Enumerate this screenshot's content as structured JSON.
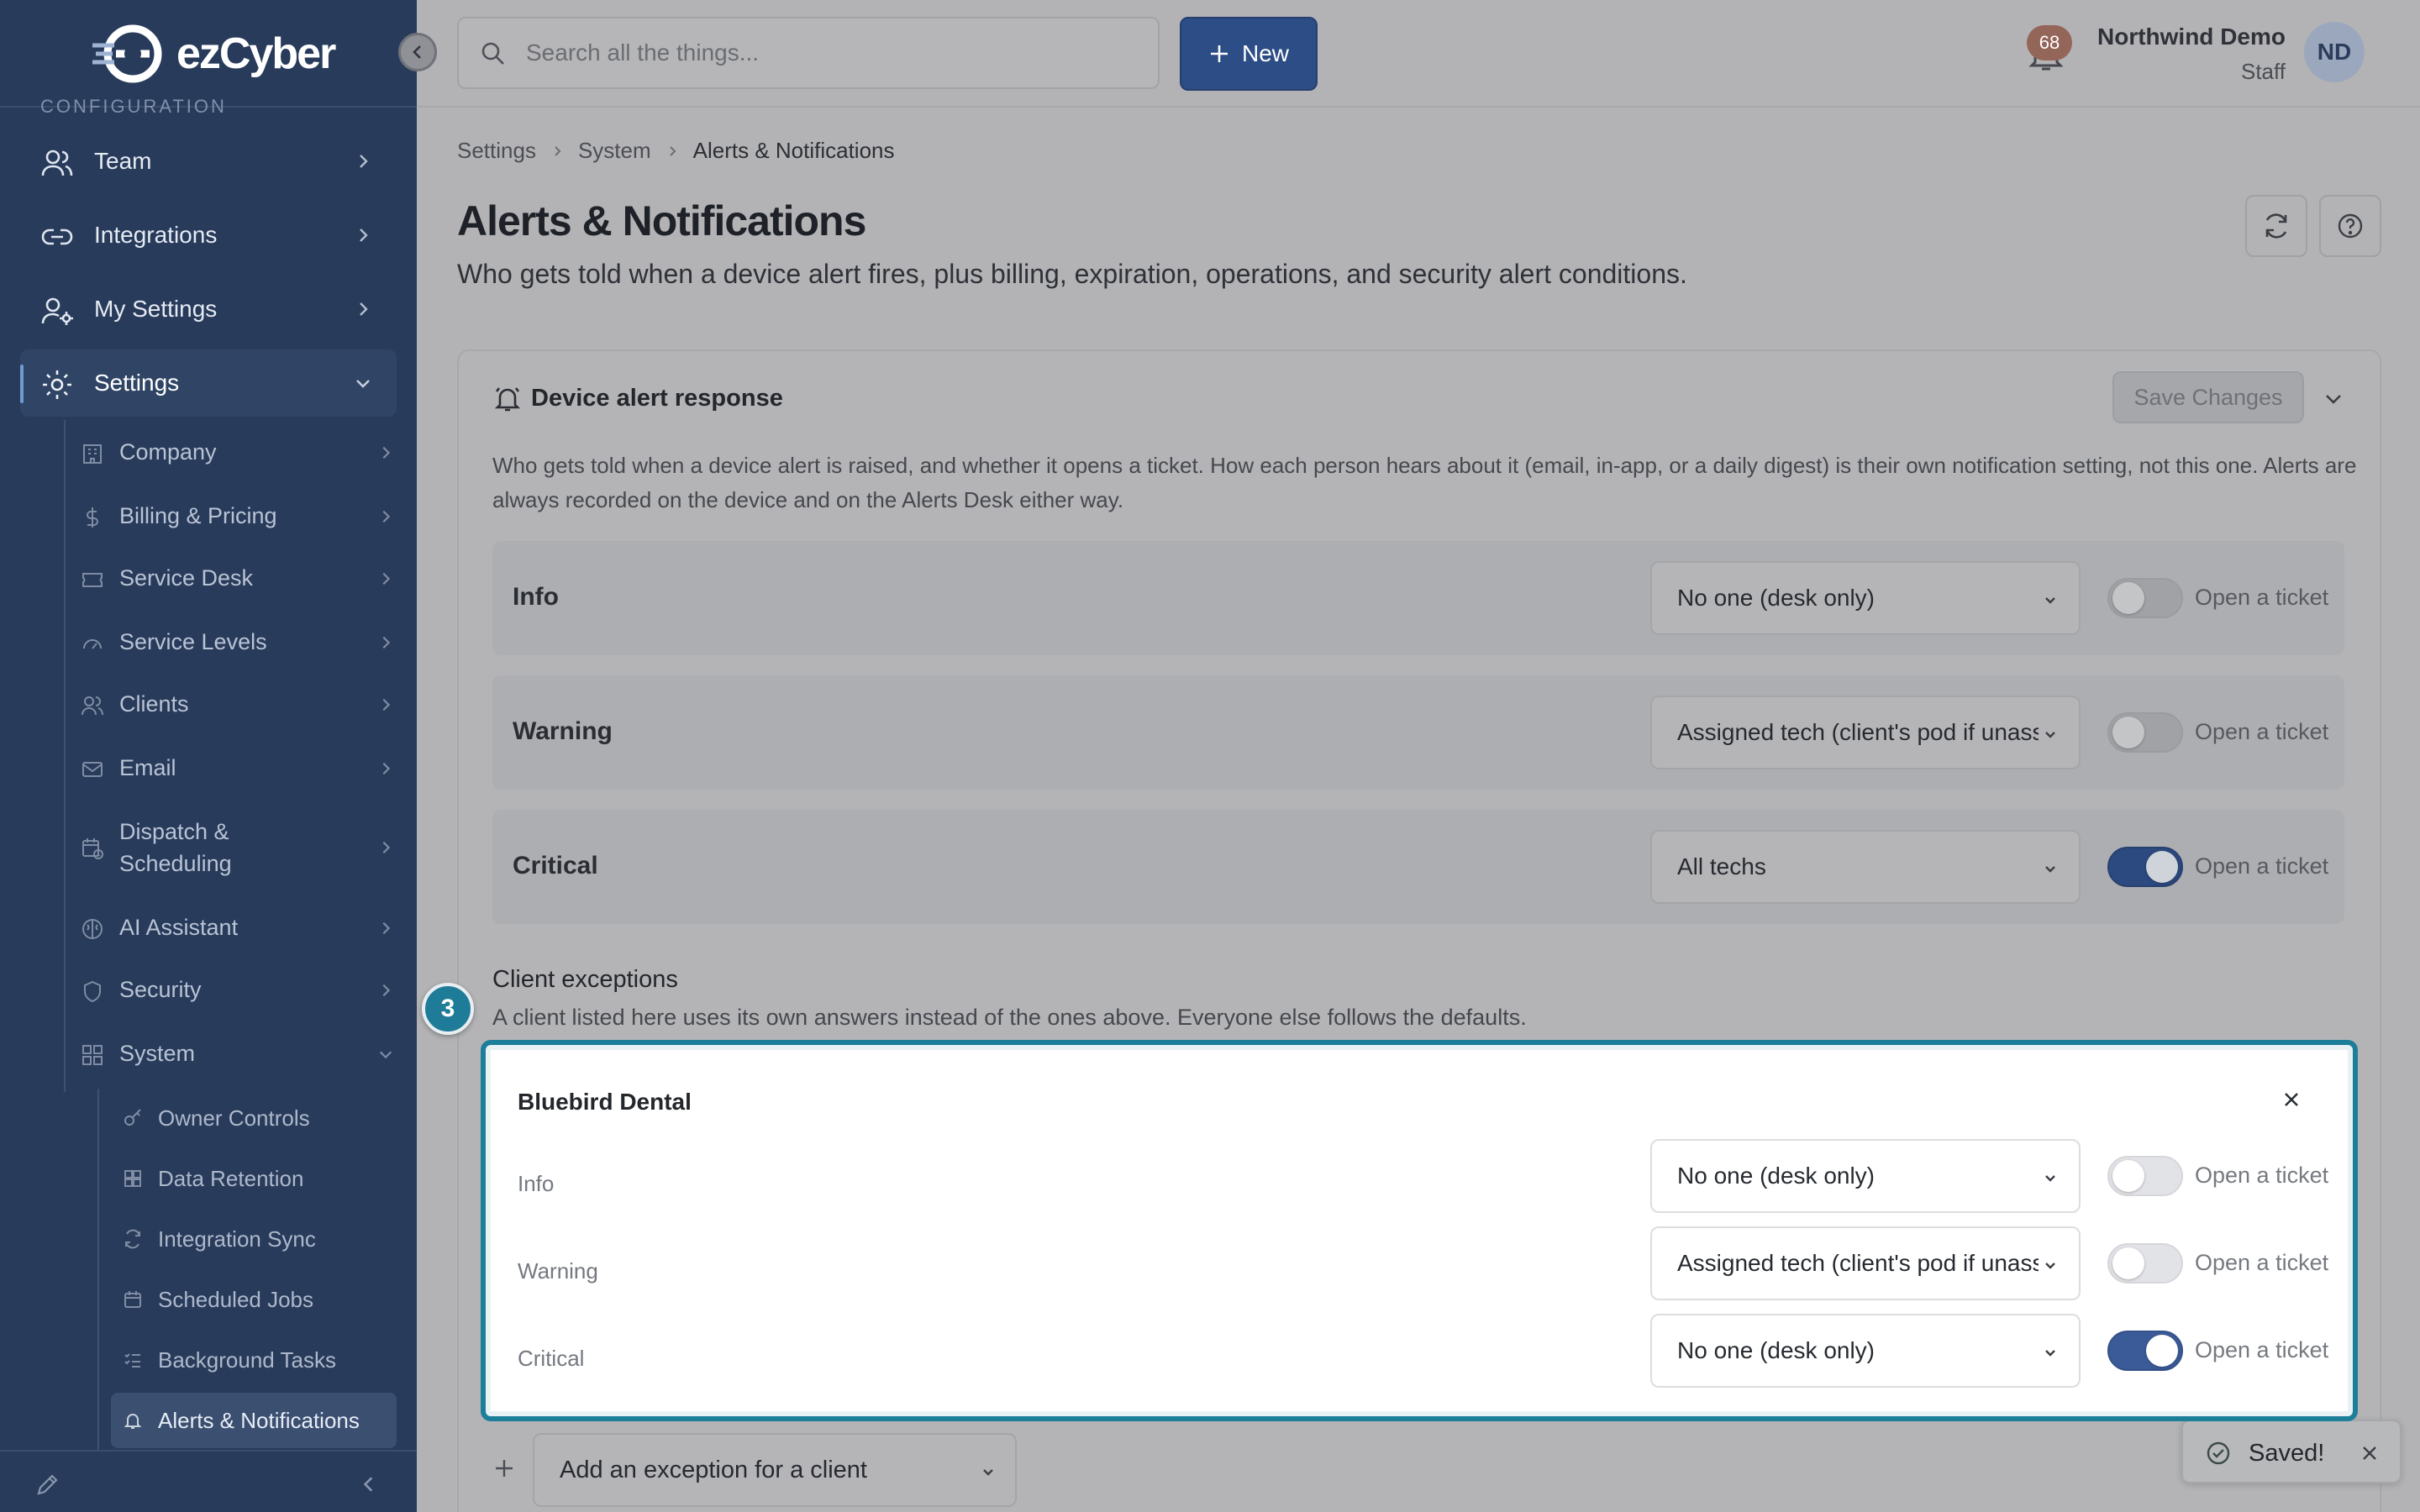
{
  "app": {
    "name_prefix": "ez",
    "name": "ezCyber"
  },
  "sidebar": {
    "section_label": "CONFIGURATION",
    "items": [
      {
        "label": "Team"
      },
      {
        "label": "Integrations"
      },
      {
        "label": "My Settings"
      },
      {
        "label": "Settings"
      }
    ],
    "settings_children": [
      {
        "label": "Company"
      },
      {
        "label": "Billing & Pricing"
      },
      {
        "label": "Service Desk"
      },
      {
        "label": "Service Levels"
      },
      {
        "label": "Clients"
      },
      {
        "label": "Email"
      },
      {
        "label": "Dispatch & Scheduling"
      },
      {
        "label": "AI Assistant"
      },
      {
        "label": "Security"
      },
      {
        "label": "System"
      }
    ],
    "system_children": [
      {
        "label": "Owner Controls"
      },
      {
        "label": "Data Retention"
      },
      {
        "label": "Integration Sync"
      },
      {
        "label": "Scheduled Jobs"
      },
      {
        "label": "Background Tasks"
      },
      {
        "label": "Alerts & Notifications"
      }
    ]
  },
  "topbar": {
    "search_placeholder": "Search all the things...",
    "new_label": "New",
    "notification_count": "68",
    "user_name": "Northwind Demo",
    "user_role": "Staff",
    "avatar_initials": "ND"
  },
  "breadcrumb": [
    "Settings",
    "System",
    "Alerts & Notifications"
  ],
  "page": {
    "title": "Alerts & Notifications",
    "subtitle": "Who gets told when a device alert fires, plus billing, expiration, operations, and security alert conditions."
  },
  "card": {
    "title": "Device alert response",
    "save_label": "Save Changes",
    "description": "Who gets told when a device alert is raised, and whether it opens a ticket. How each person hears about it (email, in-app, or a daily digest) is their own notification setting, not this one. Alerts are always recorded on the device and on the Alerts Desk either way.",
    "toggle_label": "Open a ticket",
    "severities": [
      {
        "label": "Info",
        "recipient": "No one (desk only)",
        "open_ticket": false
      },
      {
        "label": "Warning",
        "recipient": "Assigned tech (client's pod if unassigned)",
        "open_ticket": false
      },
      {
        "label": "Critical",
        "recipient": "All techs",
        "open_ticket": true
      }
    ]
  },
  "exceptions": {
    "title": "Client exceptions",
    "subtitle": "A client listed here uses its own answers instead of the ones above. Everyone else follows the defaults.",
    "step_number": "3",
    "client": {
      "name": "Bluebird Dental",
      "rows": [
        {
          "label": "Info",
          "recipient": "No one (desk only)",
          "open_ticket": false
        },
        {
          "label": "Warning",
          "recipient": "Assigned tech (client's pod if unassigned)",
          "open_ticket": false
        },
        {
          "label": "Critical",
          "recipient": "No one (desk only)",
          "open_ticket": true
        }
      ]
    },
    "add_placeholder": "Add an exception for a client"
  },
  "toast": {
    "message": "Saved!"
  },
  "colors": {
    "accent": "#2d4d87",
    "highlight": "#1d7e9a",
    "sidebar": "#283b5b"
  }
}
